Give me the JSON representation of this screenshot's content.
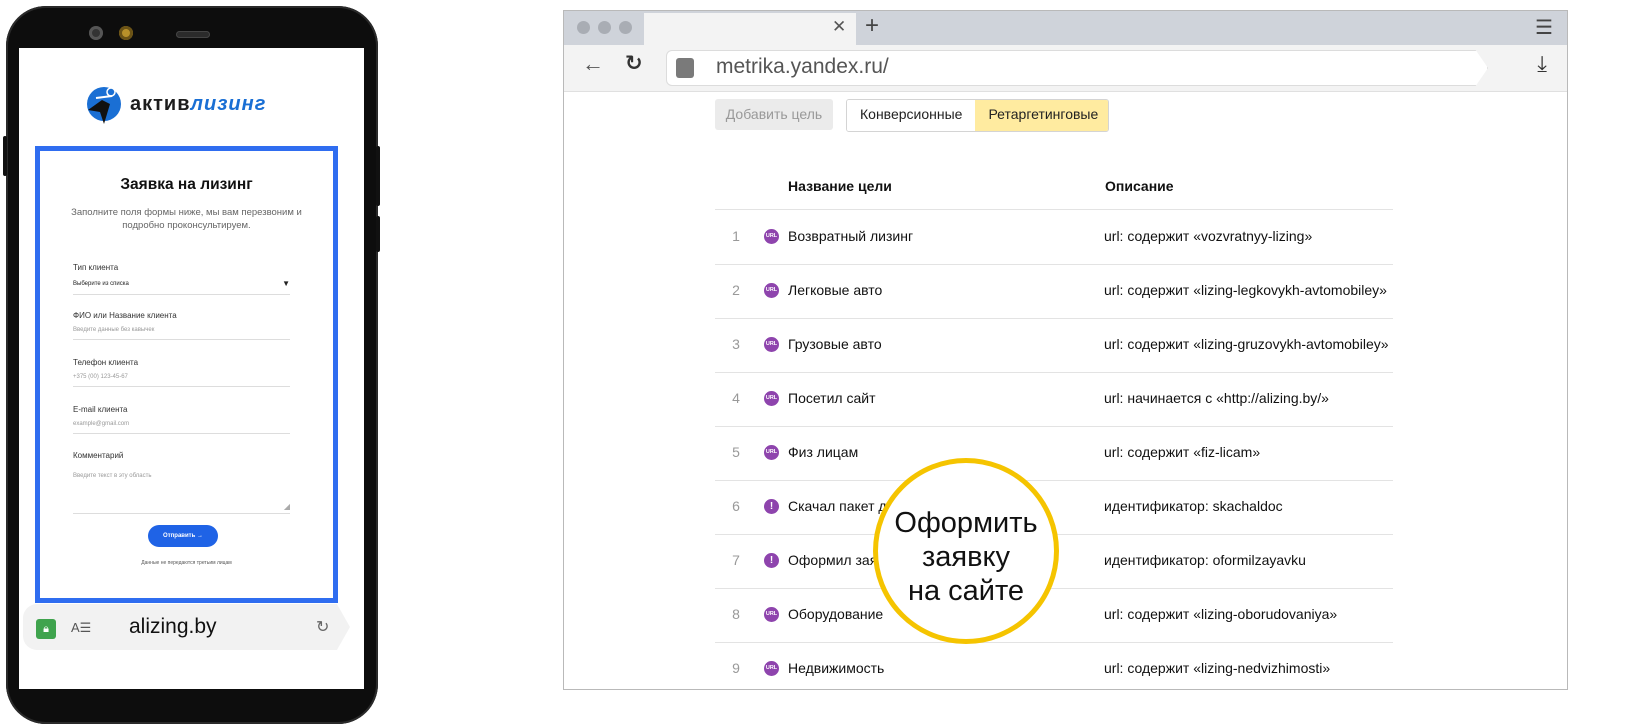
{
  "phone": {
    "logo": {
      "part1": "актив",
      "part2": "лизинг"
    },
    "form": {
      "title": "Заявка на лизинг",
      "subtitle": "Заполните поля формы ниже, мы вам перезвоним и подробно проконсультируем.",
      "fields": [
        {
          "label": "Тип клиента",
          "value": "Выберите из списка"
        },
        {
          "label": "ФИО или Название клиента",
          "value": "Введите данные без кавычек"
        },
        {
          "label": "Телефон клиента",
          "value": "+375 (00) 123-45-67"
        },
        {
          "label": "E-mail клиента",
          "value": "example@gmail.com"
        },
        {
          "label": "Комментарий",
          "value": "Введите текст в эту область"
        }
      ],
      "submit_label": "Отправить →",
      "disclaimer": "Данные не передаются третьим лицам"
    },
    "url": "alizing.by"
  },
  "browser": {
    "url": "metrika.yandex.ru/",
    "add_goal_label": "Добавить цель",
    "segments": [
      "Конверсионные",
      "Ретаргетинговые"
    ],
    "active_segment": 1,
    "headers": {
      "name": "Название цели",
      "description": "Описание"
    },
    "rows": [
      {
        "num": "1",
        "icon": "URL",
        "name": "Возвратный лизинг",
        "desc": "url: содержит «vozvratnyy-lizing»"
      },
      {
        "num": "2",
        "icon": "URL",
        "name": "Легковые авто",
        "desc": "url: содержит «lizing-legkovykh-avtomobiley»"
      },
      {
        "num": "3",
        "icon": "URL",
        "name": "Грузовые авто",
        "desc": "url: содержит «lizing-gruzovykh-avtomobiley»"
      },
      {
        "num": "4",
        "icon": "URL",
        "name": "Посетил сайт",
        "desc": "url: начинается с «http://alizing.by/»"
      },
      {
        "num": "5",
        "icon": "URL",
        "name": "Физ лицам",
        "desc": "url: содержит «fiz-licam»"
      },
      {
        "num": "6",
        "icon": "!",
        "name": "Скачал пакет до",
        "desc": "идентификатор: skachaldoc"
      },
      {
        "num": "7",
        "icon": "!",
        "name": "Оформил заяв",
        "desc": "идентификатор: oformilzayavku"
      },
      {
        "num": "8",
        "icon": "URL",
        "name": "Оборудование",
        "desc": "url: содержит «lizing-oborudovaniya»"
      },
      {
        "num": "9",
        "icon": "URL",
        "name": "Недвижимость",
        "desc": "url: содержит «lizing-nedvizhimosti»"
      }
    ]
  },
  "callout": {
    "line1": "Оформить",
    "line2": "заявку",
    "line3": "на сайте"
  },
  "colors": {
    "form_border": "#2f6df0",
    "goal_icon": "#8e44ad",
    "active_tab": "#ffeba0",
    "callout_ring": "#f5c400"
  }
}
